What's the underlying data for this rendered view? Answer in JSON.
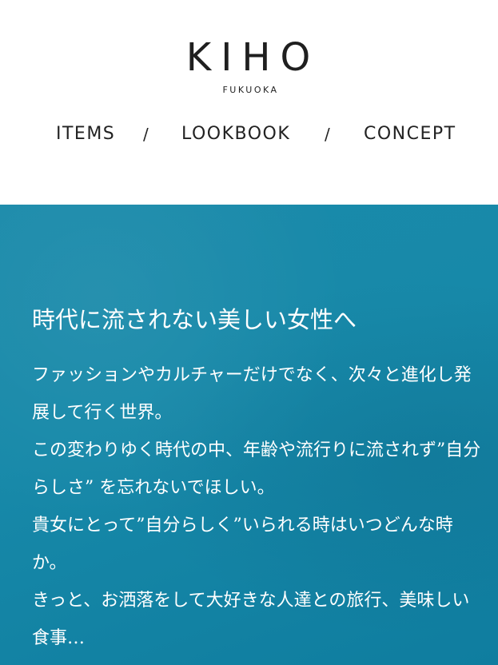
{
  "header": {
    "logo": "KIHO",
    "logo_sub": "FUKUOKA",
    "nav": {
      "items": [
        "ITEMS",
        "LOOKBOOK",
        "CONCEPT"
      ],
      "separator": "/"
    }
  },
  "hero": {
    "background_color": "#1789a9",
    "title": "時代に流されない美しい女性へ",
    "paragraphs": [
      "ファッションやカルチャーだけでなく、次々と進化し発展して行く世界。",
      "この変わりゆく時代の中、年齢や流行りに流されず”自分らしさ” を忘れないでほしい。",
      "貴女にとって”自分らしく”いられる時はいつどんな時か。",
      "きっと、お洒落をして大好きな人達との旅行、美味しい食事…"
    ]
  }
}
